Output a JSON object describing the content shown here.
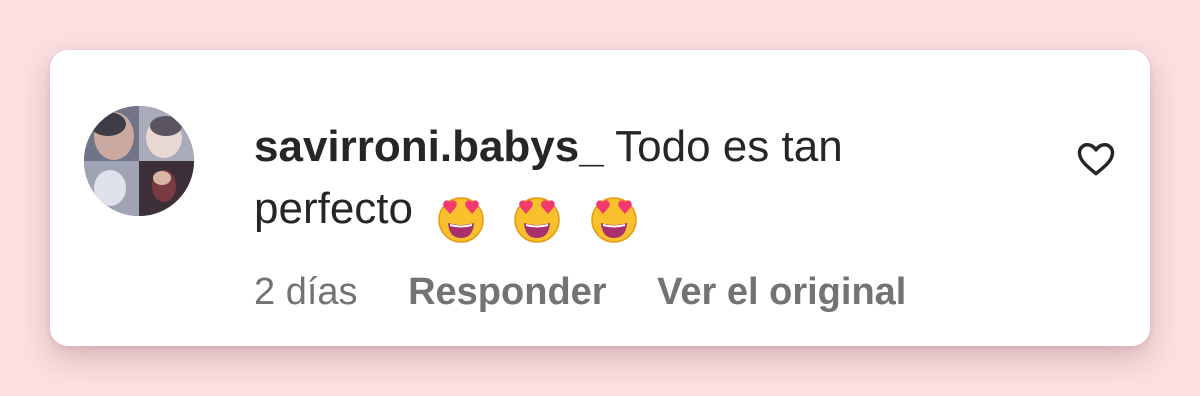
{
  "comment": {
    "username": "savirroni.babys_",
    "text": "Todo es tan perfecto",
    "emojis": [
      "smiling-face-with-heart-eyes",
      "smiling-face-with-heart-eyes",
      "smiling-face-with-heart-eyes"
    ]
  },
  "meta": {
    "time": "2 días",
    "reply_label": "Responder",
    "translate_label": "Ver el original"
  },
  "icons": {
    "like": "heart-outline-icon"
  },
  "colors": {
    "background": "#fbdfe1",
    "card": "#ffffff",
    "text_primary": "#262626",
    "text_secondary": "#737373"
  }
}
